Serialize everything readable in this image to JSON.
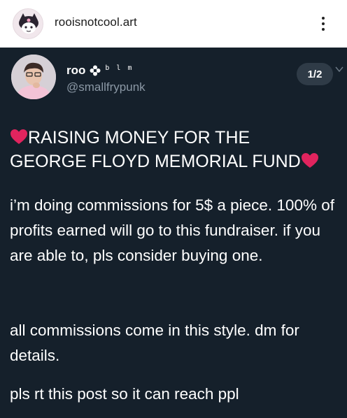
{
  "header": {
    "username": "rooisnotcool.art",
    "avatar_icon": "kuromi-avatar-icon",
    "more_icon": "more-vertical-icon"
  },
  "tweet": {
    "background": "#15202b",
    "display_name": "roo",
    "badge_icon": "flower-icon",
    "name_suffix": "b l m",
    "handle": "@smallfrypunk",
    "page_indicator": "1/2",
    "headline_line1": "RAISING MONEY FOR THE",
    "headline_line2": "GEORGE FLOYD MEMORIAL FUND",
    "heart_color": "#e0245e",
    "paragraphs": [
      "i’m doing commissions for 5$ a piece. 100% of profits earned will go to this fundraiser. if you are able to, pls consider buying one.",
      "all commissions come in this style. dm for details.",
      "pls rt this post so it can reach ppl"
    ]
  }
}
